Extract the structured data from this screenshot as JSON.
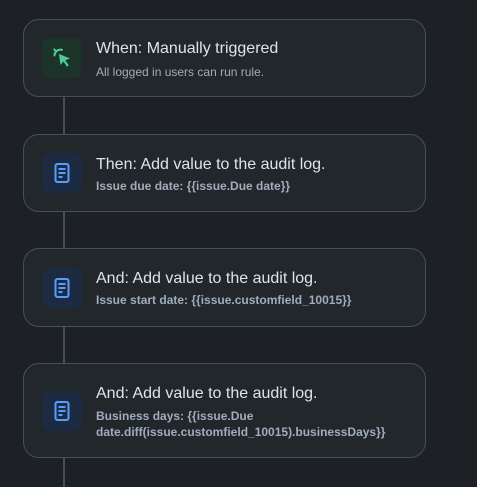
{
  "flow": {
    "trigger": {
      "title": "When: Manually triggered",
      "subtitle": "All logged in users can run rule.",
      "icon": "cursor-click-icon",
      "color": "#4bce97"
    },
    "actions": [
      {
        "title": "Then: Add value to the audit log.",
        "detail": "Issue due date: {{issue.Due date}}",
        "icon": "document-icon"
      },
      {
        "title": "And: Add value to the audit log.",
        "detail": "Issue start date: {{issue.customfield_10015}}",
        "icon": "document-icon"
      },
      {
        "title": "And: Add value to the audit log.",
        "detail_line1": "Business days: {{issue.Due",
        "detail_line2": "date.diff(issue.customfield_10015).businessDays}}",
        "icon": "document-icon"
      }
    ],
    "action_color": "#579dff"
  }
}
